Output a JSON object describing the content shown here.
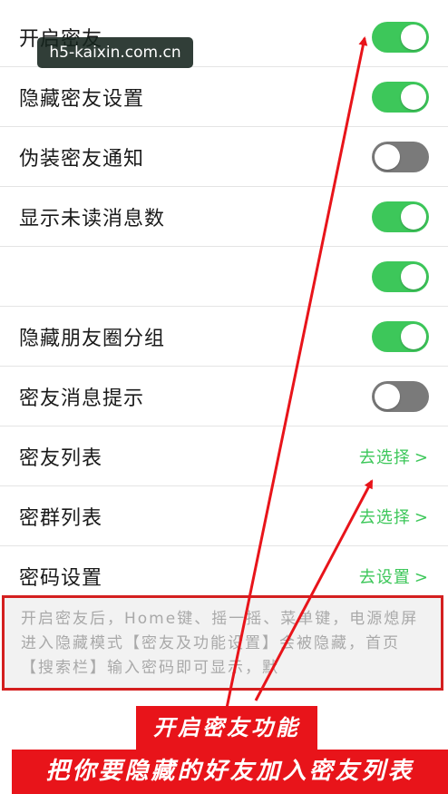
{
  "watermark": "h5-kaixin.com.cn",
  "settings": [
    {
      "label": "开启密友",
      "toggle": "on"
    },
    {
      "label": "隐藏密友设置",
      "toggle": "on"
    },
    {
      "label": "伪装密友通知",
      "toggle": "off"
    },
    {
      "label": "显示未读消息数",
      "toggle": "on"
    },
    {
      "label": "",
      "toggle": "on"
    },
    {
      "label": "隐藏朋友圈分组",
      "toggle": "on"
    },
    {
      "label": "密友消息提示",
      "toggle": "off"
    },
    {
      "label": "密友列表",
      "link": "去选择"
    },
    {
      "label": "密群列表",
      "link": "去选择"
    },
    {
      "label": "密码设置",
      "link": "去设置"
    }
  ],
  "chevron": ">",
  "note": "开启密友后，Home键、摇一摇、菜单键，电源熄屏进入隐藏模式【密友及功能设置】会被隐藏，首页【搜索栏】输入密码即可显示，默",
  "annotations": {
    "line1": "开启密友功能",
    "line2": "把你要隐藏的好友加入密友列表"
  },
  "colors": {
    "toggle_on": "#3dc75a",
    "toggle_off": "#7a7a7a",
    "link": "#3dc75a",
    "annotation": "#e8141a"
  }
}
